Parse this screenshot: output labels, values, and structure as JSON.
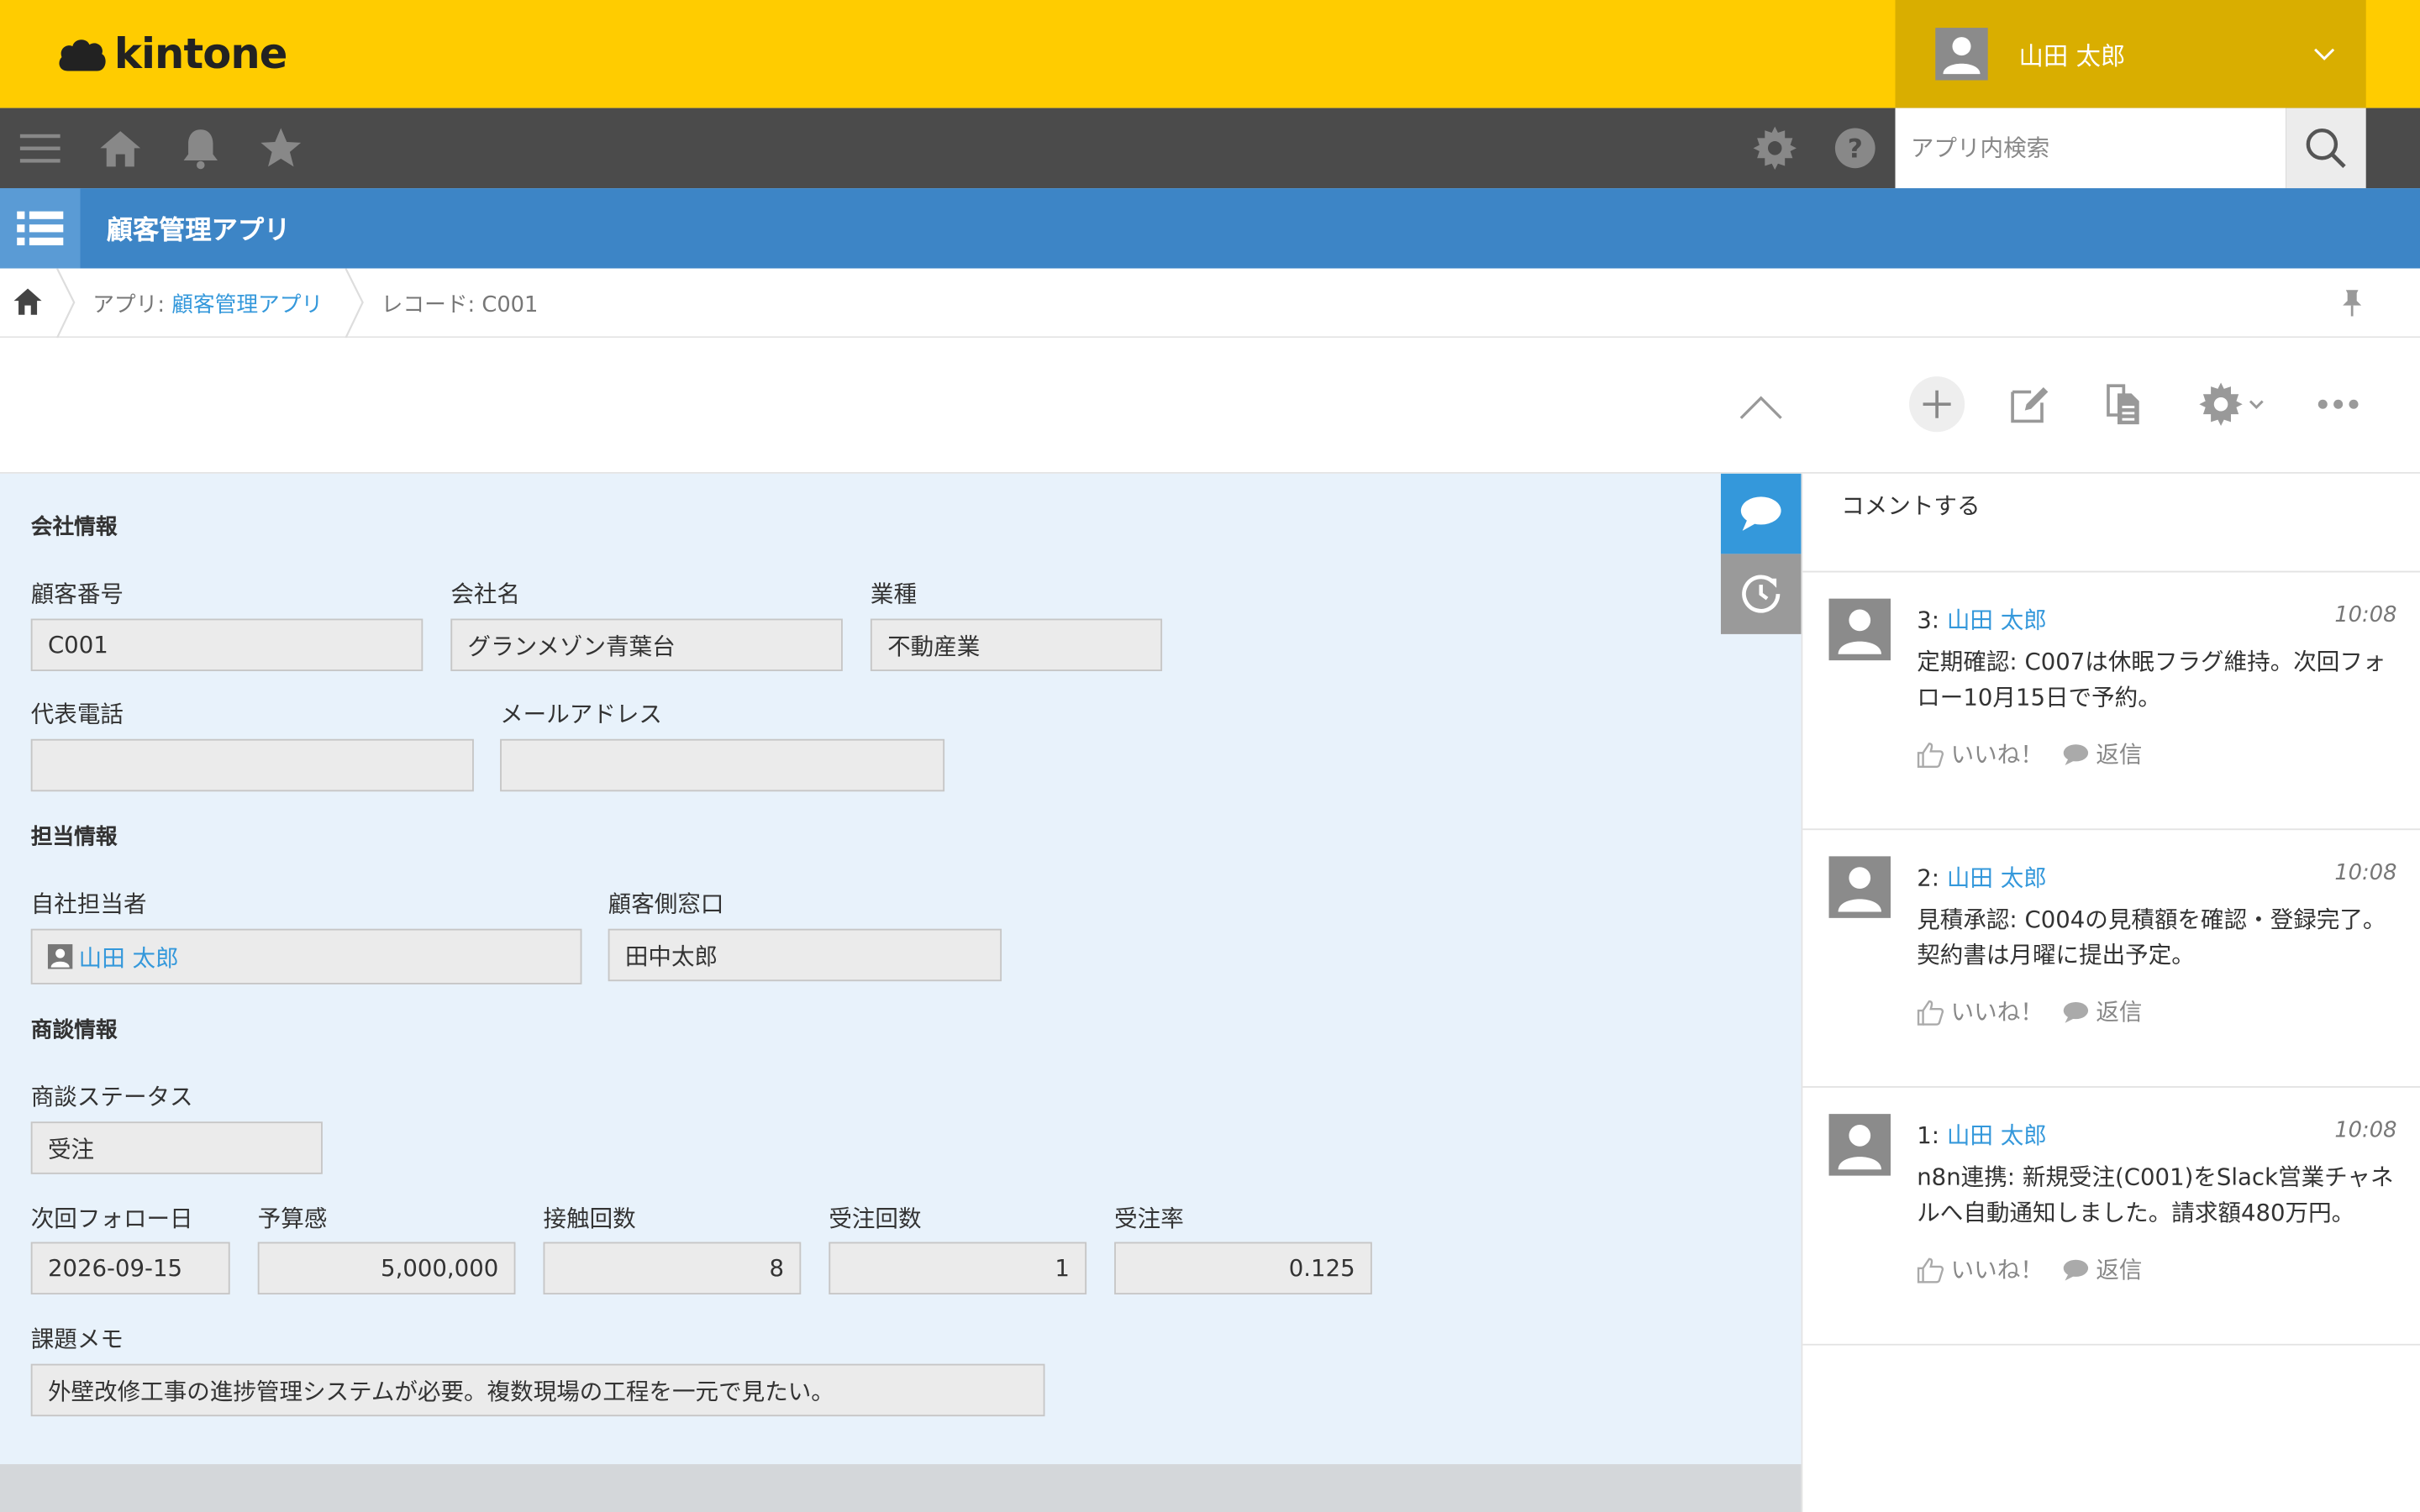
{
  "header": {
    "logo_text": "kintone",
    "user_name": "山田 太郎"
  },
  "nav": {
    "search_placeholder": "アプリ内検索"
  },
  "app": {
    "title": "顧客管理アプリ"
  },
  "breadcrumb": {
    "app_prefix": "アプリ: ",
    "app_name": "顧客管理アプリ",
    "record": "レコード: C001"
  },
  "record": {
    "sections": {
      "company": "会社情報",
      "owner": "担当情報",
      "deal": "商談情報"
    },
    "fields": {
      "customer_no": {
        "label": "顧客番号",
        "value": "C001"
      },
      "company_name": {
        "label": "会社名",
        "value": "グランメゾン青葉台"
      },
      "industry": {
        "label": "業種",
        "value": "不動産業"
      },
      "phone": {
        "label": "代表電話",
        "value": ""
      },
      "email": {
        "label": "メールアドレス",
        "value": ""
      },
      "owner": {
        "label": "自社担当者",
        "value": "山田 太郎"
      },
      "contact": {
        "label": "顧客側窓口",
        "value": "田中太郎"
      },
      "deal_status": {
        "label": "商談ステータス",
        "value": "受注"
      },
      "next_follow": {
        "label": "次回フォロー日",
        "value": "2026-09-15"
      },
      "budget": {
        "label": "予算感",
        "value": "5,000,000"
      },
      "contacts_count": {
        "label": "接触回数",
        "value": "8"
      },
      "orders_count": {
        "label": "受注回数",
        "value": "1"
      },
      "order_rate": {
        "label": "受注率",
        "value": "0.125"
      },
      "memo": {
        "label": "課題メモ",
        "value": "外壁改修工事の進捗管理システムが必要。複数現場の工程を一元で見たい。"
      }
    }
  },
  "comments": {
    "input_placeholder": "コメントする",
    "like_label": "いいね！",
    "reply_label": "返信",
    "items": [
      {
        "number": "3:",
        "author": "山田 太郎",
        "time": "10:08",
        "body": "定期確認: C007は休眠フラグ維持。次回フォロー10月15日で予約。"
      },
      {
        "number": "2:",
        "author": "山田 太郎",
        "time": "10:08",
        "body": "見積承認: C004の見積額を確認・登録完了。契約書は月曜に提出予定。"
      },
      {
        "number": "1:",
        "author": "山田 太郎",
        "time": "10:08",
        "body": "n8n連携: 新規受注(C001)をSlack営業チャネルへ自動通知しました。請求額480万円。"
      }
    ]
  },
  "colors": {
    "header_yellow": "#ffcc00",
    "nav_dark": "#4b4b4b",
    "app_blue": "#3d85c6",
    "link_blue": "#3498db",
    "record_bg": "#e8f2fb"
  }
}
